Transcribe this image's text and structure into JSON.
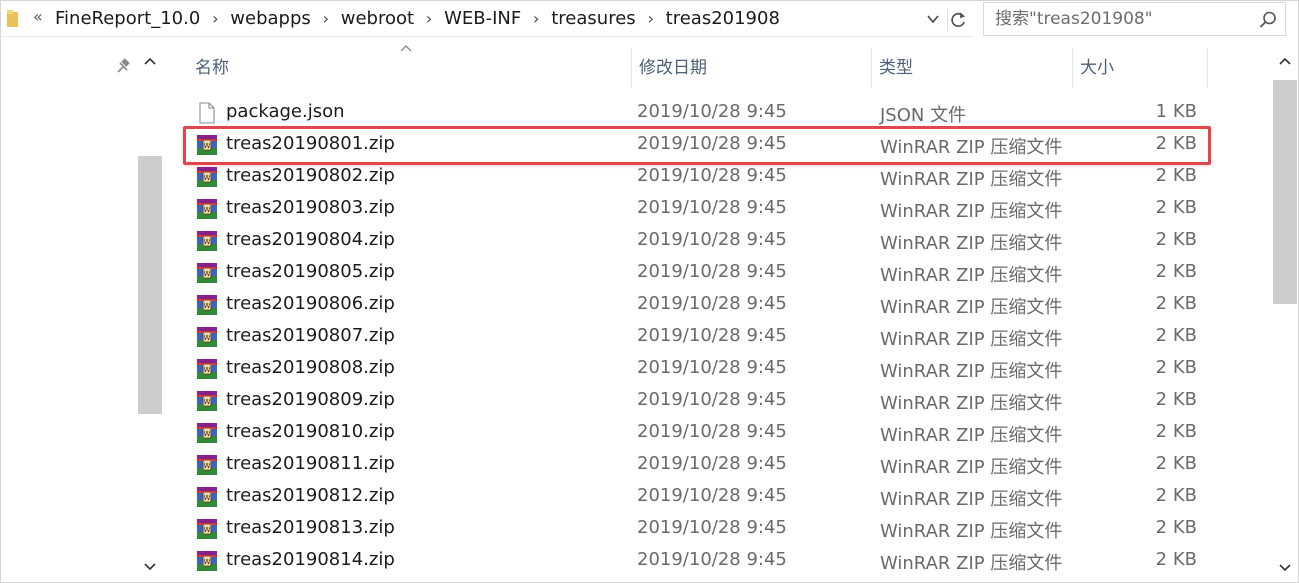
{
  "breadcrumb": {
    "overflow": "«",
    "segments": [
      "FineReport_10.0",
      "webapps",
      "webroot",
      "WEB-INF",
      "treasures",
      "treas201908"
    ]
  },
  "search": {
    "placeholder": "搜索\"treas201908\""
  },
  "columns": {
    "name": "名称",
    "date": "修改日期",
    "type": "类型",
    "size": "大小"
  },
  "files": [
    {
      "name": "package.json",
      "date": "2019/10/28 9:45",
      "type": "JSON 文件",
      "size": "1 KB",
      "icon": "json-file-icon"
    },
    {
      "name": "treas20190801.zip",
      "date": "2019/10/28 9:45",
      "type": "WinRAR ZIP 压缩文件",
      "size": "2 KB",
      "icon": "winrar-zip-icon"
    },
    {
      "name": "treas20190802.zip",
      "date": "2019/10/28 9:45",
      "type": "WinRAR ZIP 压缩文件",
      "size": "2 KB",
      "icon": "winrar-zip-icon"
    },
    {
      "name": "treas20190803.zip",
      "date": "2019/10/28 9:45",
      "type": "WinRAR ZIP 压缩文件",
      "size": "2 KB",
      "icon": "winrar-zip-icon"
    },
    {
      "name": "treas20190804.zip",
      "date": "2019/10/28 9:45",
      "type": "WinRAR ZIP 压缩文件",
      "size": "2 KB",
      "icon": "winrar-zip-icon"
    },
    {
      "name": "treas20190805.zip",
      "date": "2019/10/28 9:45",
      "type": "WinRAR ZIP 压缩文件",
      "size": "2 KB",
      "icon": "winrar-zip-icon"
    },
    {
      "name": "treas20190806.zip",
      "date": "2019/10/28 9:45",
      "type": "WinRAR ZIP 压缩文件",
      "size": "2 KB",
      "icon": "winrar-zip-icon"
    },
    {
      "name": "treas20190807.zip",
      "date": "2019/10/28 9:45",
      "type": "WinRAR ZIP 压缩文件",
      "size": "2 KB",
      "icon": "winrar-zip-icon"
    },
    {
      "name": "treas20190808.zip",
      "date": "2019/10/28 9:45",
      "type": "WinRAR ZIP 压缩文件",
      "size": "2 KB",
      "icon": "winrar-zip-icon"
    },
    {
      "name": "treas20190809.zip",
      "date": "2019/10/28 9:45",
      "type": "WinRAR ZIP 压缩文件",
      "size": "2 KB",
      "icon": "winrar-zip-icon"
    },
    {
      "name": "treas20190810.zip",
      "date": "2019/10/28 9:45",
      "type": "WinRAR ZIP 压缩文件",
      "size": "2 KB",
      "icon": "winrar-zip-icon"
    },
    {
      "name": "treas20190811.zip",
      "date": "2019/10/28 9:45",
      "type": "WinRAR ZIP 压缩文件",
      "size": "2 KB",
      "icon": "winrar-zip-icon"
    },
    {
      "name": "treas20190812.zip",
      "date": "2019/10/28 9:45",
      "type": "WinRAR ZIP 压缩文件",
      "size": "2 KB",
      "icon": "winrar-zip-icon"
    },
    {
      "name": "treas20190813.zip",
      "date": "2019/10/28 9:45",
      "type": "WinRAR ZIP 压缩文件",
      "size": "2 KB",
      "icon": "winrar-zip-icon"
    },
    {
      "name": "treas20190814.zip",
      "date": "2019/10/28 9:45",
      "type": "WinRAR ZIP 压缩文件",
      "size": "2 KB",
      "icon": "winrar-zip-icon"
    }
  ],
  "colors": {
    "highlight": "#e0474c",
    "header_text": "#4c607a",
    "scroll_thumb": "#cdcdcd"
  }
}
